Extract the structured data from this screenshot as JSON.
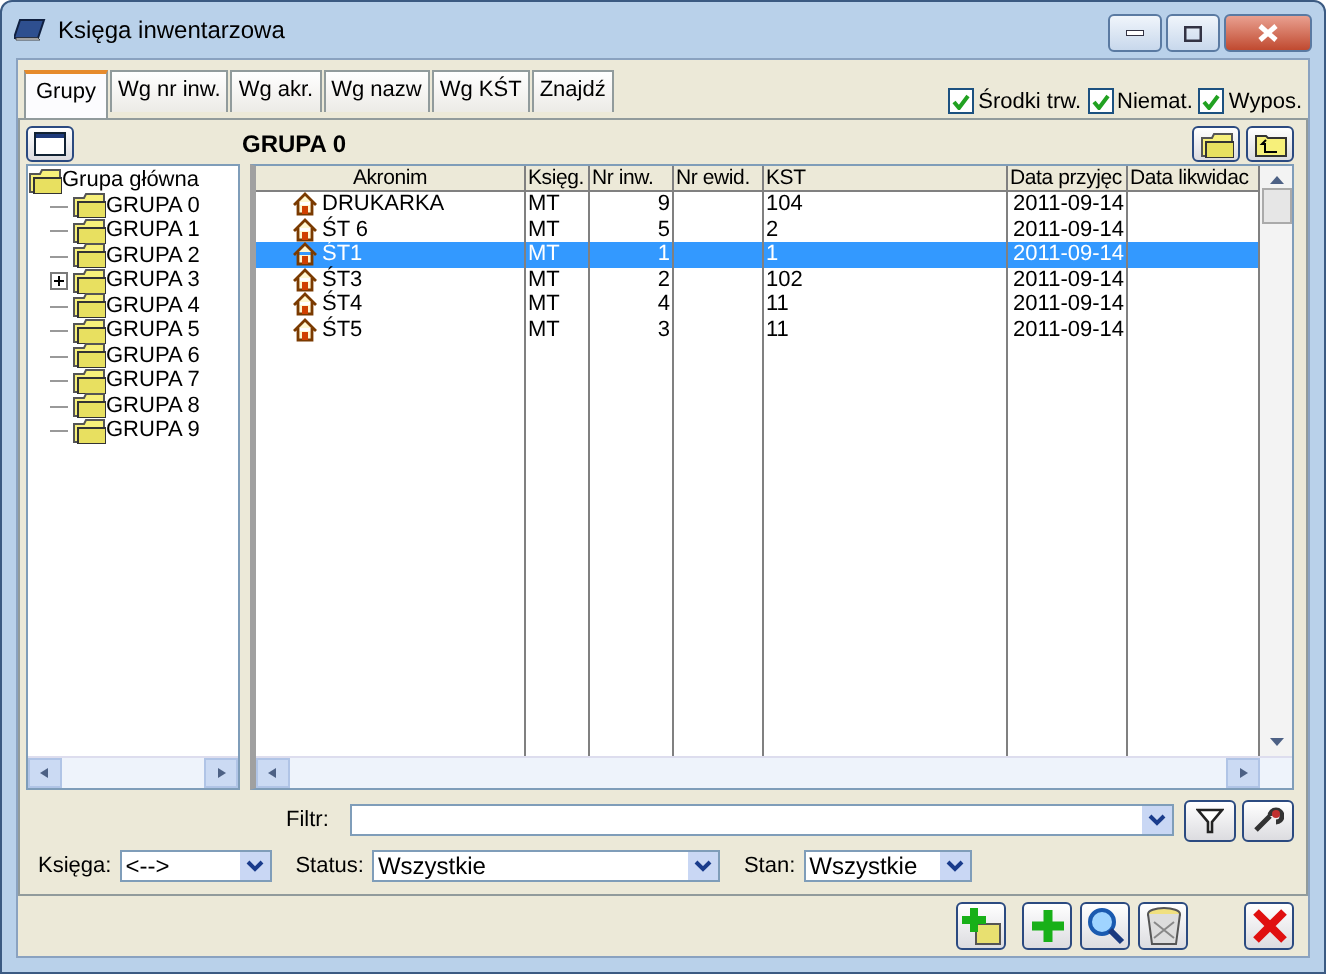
{
  "window": {
    "title": "Księga inwentarzowa"
  },
  "tabs": [
    {
      "label": "Grupy",
      "selected": true
    },
    {
      "label": "Wg nr inw.",
      "selected": false
    },
    {
      "label": "Wg akr.",
      "selected": false
    },
    {
      "label": "Wg nazw",
      "selected": false
    },
    {
      "label": "Wg KŚT",
      "selected": false
    },
    {
      "label": "Znajdź",
      "selected": false
    }
  ],
  "filters": [
    {
      "label": "Środki trw.",
      "checked": true
    },
    {
      "label": "Niemat.",
      "checked": true
    },
    {
      "label": "Wypos.",
      "checked": true
    }
  ],
  "group_title": "GRUPA 0",
  "tree": {
    "label": "Grupa główna",
    "children": [
      {
        "label": "GRUPA 0",
        "expandable": false
      },
      {
        "label": "GRUPA 1",
        "expandable": false
      },
      {
        "label": "GRUPA 2",
        "expandable": false
      },
      {
        "label": "GRUPA 3",
        "expandable": true
      },
      {
        "label": "GRUPA 4",
        "expandable": false
      },
      {
        "label": "GRUPA 5",
        "expandable": false
      },
      {
        "label": "GRUPA 6",
        "expandable": false
      },
      {
        "label": "GRUPA 7",
        "expandable": false
      },
      {
        "label": "GRUPA 8",
        "expandable": false
      },
      {
        "label": "GRUPA 9",
        "expandable": false
      }
    ]
  },
  "table": {
    "columns": [
      "Akronim",
      "Księg.",
      "Nr inw.",
      "Nr ewid.",
      "KST",
      "Data przyjęc",
      "Data likwidac"
    ],
    "rows": [
      {
        "cells": [
          "DRUKARKA",
          "MT",
          "9",
          "",
          "104",
          "2011-09-14",
          ""
        ],
        "selected": false
      },
      {
        "cells": [
          "ŚT 6",
          "MT",
          "5",
          "",
          "2",
          "2011-09-14",
          ""
        ],
        "selected": false
      },
      {
        "cells": [
          "ŚT1",
          "MT",
          "1",
          "",
          "1",
          "2011-09-14",
          ""
        ],
        "selected": true
      },
      {
        "cells": [
          "ŚT3",
          "MT",
          "2",
          "",
          "102",
          "2011-09-14",
          ""
        ],
        "selected": false
      },
      {
        "cells": [
          "ŚT4",
          "MT",
          "4",
          "",
          "11",
          "2011-09-14",
          ""
        ],
        "selected": false
      },
      {
        "cells": [
          "ŚT5",
          "MT",
          "3",
          "",
          "11",
          "2011-09-14",
          ""
        ],
        "selected": false
      }
    ]
  },
  "filter": {
    "label": "Filtr:"
  },
  "selectors": [
    {
      "label": "Księga:",
      "value": "<-->"
    },
    {
      "label": "Status:",
      "value": "Wszystkie"
    },
    {
      "label": "Stan:",
      "value": "Wszystkie"
    }
  ]
}
